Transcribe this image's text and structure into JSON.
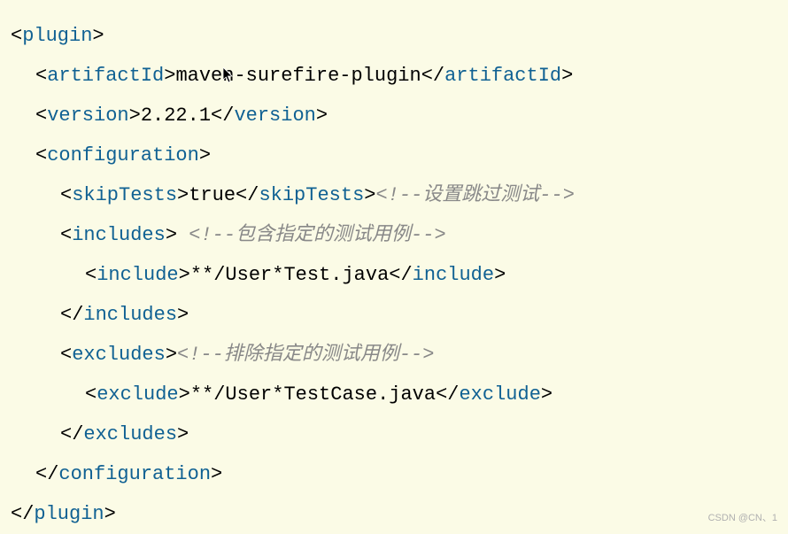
{
  "tags": {
    "plugin": "plugin",
    "artifactId": "artifactId",
    "version": "version",
    "configuration": "configuration",
    "skipTests": "skipTests",
    "includes": "includes",
    "include": "include",
    "excludes": "excludes",
    "exclude": "exclude"
  },
  "values": {
    "artifactId": "maven-surefire-plugin",
    "version": "2.22.1",
    "skipTests": "true",
    "include": "**/User*Test.java",
    "exclude": "**/User*TestCase.java"
  },
  "comments": {
    "skipTests": "<!--设置跳过测试-->",
    "includes": " <!--包含指定的测试用例-->",
    "excludes": "<!--排除指定的测试用例-->"
  },
  "watermark": "CSDN @CN、1"
}
